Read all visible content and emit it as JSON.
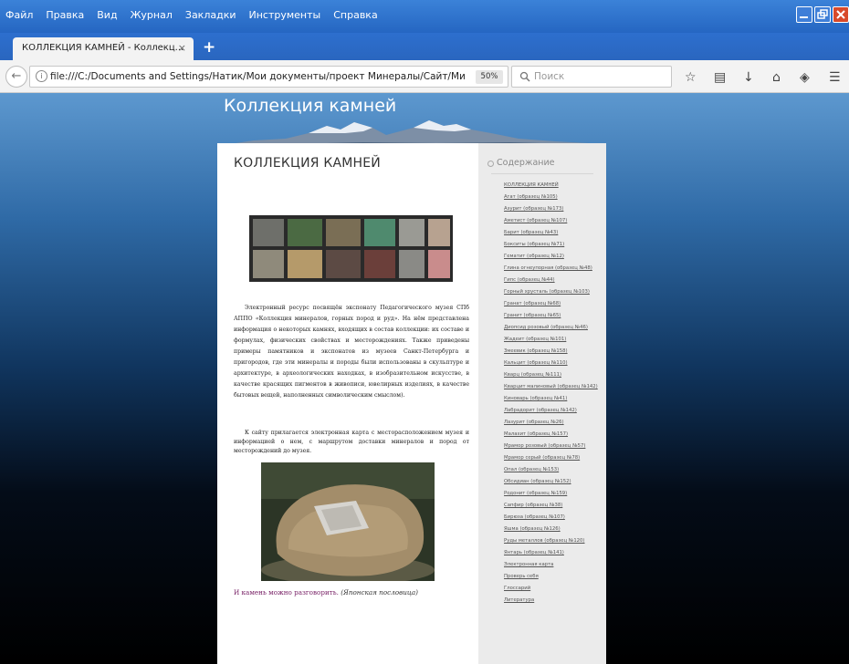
{
  "menubar": {
    "items": [
      "Файл",
      "Правка",
      "Вид",
      "Журнал",
      "Закладки",
      "Инструменты",
      "Справка"
    ]
  },
  "tab": {
    "title": "КОЛЛЕКЦИЯ КАМНЕЙ - Коллекц...",
    "close": "×",
    "new_tab": "+"
  },
  "navbar": {
    "url": "file:///C:/Documents and Settings/Натик/Мои документы/проект Минералы/Сайт/Ми",
    "zoom": "50%",
    "search_placeholder": "Поиск"
  },
  "page": {
    "site_title": "Коллекция камней",
    "heading": "КОЛЛЕКЦИЯ КАМНЕЙ",
    "paragraph1": "Электронный ресурс посвящён экспонату Педагогического музея СПб АППО «Коллекция минералов, горных пород и руд». На нём представлена информация о некоторых камнях, входящих в состав коллекции: их составе и формулах, физических свойствах и месторождениях. Также приведены примеры памятников и экспонатов из музеев Санкт-Петербурга и пригородов, где эти минералы и породы были использованы в скульптуре и архитектуре, в археологических находках, в изобразительном искусстве, в качестве красящих пигментов в живописи, ювелирных изделиях, в качестве бытовых вещей, наполненных символическим смыслом).",
    "paragraph2": "К сайту прилагается электронная карта с месторасположением музея и информацией о нем, с маршрутом доставки минералов и пород от месторождений до музея.",
    "proverb": "И камень можно разговорить.",
    "proverb_author": "(Японская пословица)"
  },
  "sidebar": {
    "heading": "Содержание",
    "items": [
      "КОЛЛЕКЦИЯ КАМНЕЙ",
      "Агат (образец №105)",
      "Азурит (образец №173)",
      "Аметист (образец №107)",
      "Барит (образец №43)",
      "Бокситы (образец №71)",
      "Гематит (образец №12)",
      "Глина огнеупорная (образец №48)",
      "Гипс (образец №44)",
      "Горный хрусталь (образец №103)",
      "Гранат (образец №68)",
      "Гранит (образец №65)",
      "Диопсид розовый (образец №46)",
      "Жадеит (образец №101)",
      "Змеевик (образец №158)",
      "Кальцит (образец №110)",
      "Кварц (образец №111)",
      "Кварцит малиновый (образец №142)",
      "Киноварь (образец №41)",
      "Лабрадорит (образец №142)",
      "Лазурит (образец №26)",
      "Малахит (образец №157)",
      "Мрамор розовый (образец №57)",
      "Мрамор серый (образец №78)",
      "Опал (образец №153)",
      "Обсидиан (образец №152)",
      "Родонит (образец №159)",
      "Сапфир (образец №38)",
      "Бирюза (образец №107)",
      "Яшма (образец №126)",
      "Руды металлов (образец №120)",
      "Янтарь (образец №141)",
      "Электронная карта",
      "Проверь себя",
      "Глоссарий",
      "Литература"
    ]
  },
  "colors": {
    "title_bar": "#2566c2",
    "page_sky_top": "#5d98cf",
    "page_bottom": "#000000",
    "proverb": "#7a2468"
  }
}
